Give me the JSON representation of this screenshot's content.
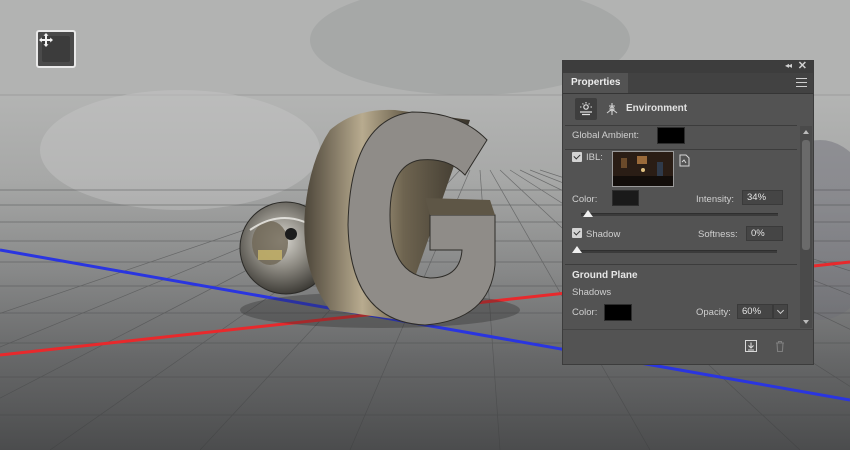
{
  "canvas": {
    "move_tool_icon": "move-icon",
    "axis_colors": {
      "red": "#e8292c",
      "blue": "#2a35e0"
    }
  },
  "panel": {
    "tab_label": "Properties",
    "collapse_glyph": "◂◂",
    "close_glyph": "✕",
    "section_title": "Environment",
    "global_ambient_label": "Global Ambient:",
    "global_ambient_color": "#000000",
    "ibl": {
      "checked": true,
      "label": "IBL:"
    },
    "color_label": "Color:",
    "light_color": "#1a1a1a",
    "intensity_label": "Intensity:",
    "intensity_value": "34%",
    "intensity_slider_fraction": 0.04,
    "shadow": {
      "checked": true,
      "label": "Shadow"
    },
    "softness_label": "Softness:",
    "softness_value": "0%",
    "softness_slider_fraction": 0.0,
    "ground_plane_title": "Ground Plane",
    "shadows_label": "Shadows",
    "ground_color_label": "Color:",
    "ground_color": "#000000",
    "opacity_label": "Opacity:",
    "opacity_value": "60%"
  }
}
